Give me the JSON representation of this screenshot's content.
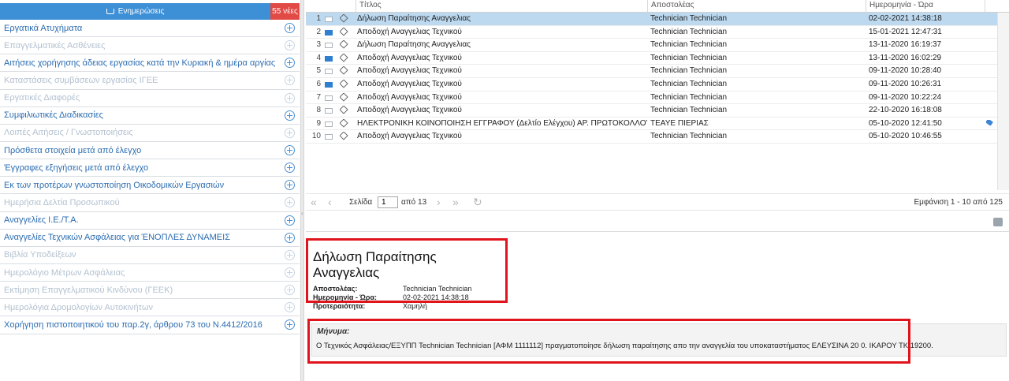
{
  "sidebar": {
    "header_label": "Ενημερώσεις",
    "header_count": "55 νέες",
    "items": [
      {
        "label": "Εργατικά Ατυχήματα",
        "enabled": true
      },
      {
        "label": "Επαγγελματικές Ασθένειες",
        "enabled": false
      },
      {
        "label": "Αιτήσεις χορήγησης άδειας εργασίας κατά την Κυριακή & ημέρα αργίας",
        "enabled": true
      },
      {
        "label": "Καταστάσεις συμβάσεων εργασίας ΙΓΕΕ",
        "enabled": false
      },
      {
        "label": "Εργατικές Διαφορές",
        "enabled": false
      },
      {
        "label": "Συμφιλιωτικές Διαδικασίες",
        "enabled": true
      },
      {
        "label": "Λοιπές Αιτήσεις / Γνωστοποιήσεις",
        "enabled": false
      },
      {
        "label": "Πρόσθετα στοιχεία μετά από έλεγχο",
        "enabled": true
      },
      {
        "label": "Έγγραφες εξηγήσεις μετά από έλεγχο",
        "enabled": true
      },
      {
        "label": "Εκ των προτέρων γνωστοποίηση Οικοδομικών Εργασιών",
        "enabled": true
      },
      {
        "label": "Ημερήσια Δελτία Προσωπικού",
        "enabled": false
      },
      {
        "label": "Αναγγελίες Ι.Ε./Τ.Α.",
        "enabled": true
      },
      {
        "label": "Αναγγελίες Τεχνικών Ασφάλειας για ΈΝΟΠΛΕΣ ΔΥΝΑΜΕΙΣ",
        "enabled": true
      },
      {
        "label": "Βιβλία Υποδείξεων",
        "enabled": false
      },
      {
        "label": "Ημερολόγιο Μέτρων Ασφάλειας",
        "enabled": false
      },
      {
        "label": "Εκτίμηση Επαγγελματικού Κινδύνου (ΓΕΕΚ)",
        "enabled": false
      },
      {
        "label": "Ημερολόγια Δρομολογίων Αυτοκινήτων",
        "enabled": false
      },
      {
        "label": "Χορήγηση πιστοποιητικού του παρ.2γ, άρθρου 73 του Ν.4412/2016",
        "enabled": true
      }
    ]
  },
  "grid": {
    "columns": {
      "title": "Τίτλος",
      "sender": "Αποστολέας",
      "date": "Ημερομηνία - Ώρα"
    },
    "rows": [
      {
        "num": "1",
        "read": true,
        "title": "Δήλωση Παραίτησης Αναγγελιας",
        "sender": "Technician Technician",
        "date": "02-02-2021 14:38:18",
        "selected": true,
        "tag": false
      },
      {
        "num": "2",
        "read": false,
        "title": "Αποδοχή Αναγγελιας Τεχνικού",
        "sender": "Technician Technician",
        "date": "15-01-2021 12:47:31",
        "selected": false,
        "tag": false
      },
      {
        "num": "3",
        "read": true,
        "title": "Δήλωση Παραίτησης Αναγγελιας",
        "sender": "Technician Technician",
        "date": "13-11-2020 16:19:37",
        "selected": false,
        "tag": false
      },
      {
        "num": "4",
        "read": false,
        "title": "Αποδοχή Αναγγελιας Τεχνικού",
        "sender": "Technician Technician",
        "date": "13-11-2020 16:02:29",
        "selected": false,
        "tag": false
      },
      {
        "num": "5",
        "read": true,
        "title": "Αποδοχή Αναγγελιας Τεχνικού",
        "sender": "Technician Technician",
        "date": "09-11-2020 10:28:40",
        "selected": false,
        "tag": false
      },
      {
        "num": "6",
        "read": false,
        "title": "Αποδοχή Αναγγελιας Τεχνικού",
        "sender": "Technician Technician",
        "date": "09-11-2020 10:26:31",
        "selected": false,
        "tag": false
      },
      {
        "num": "7",
        "read": true,
        "title": "Αποδοχή Αναγγελιας Τεχνικού",
        "sender": "Technician Technician",
        "date": "09-11-2020 10:22:24",
        "selected": false,
        "tag": false
      },
      {
        "num": "8",
        "read": true,
        "title": "Αποδοχή Αναγγελιας Τεχνικού",
        "sender": "Technician Technician",
        "date": "22-10-2020 16:18:08",
        "selected": false,
        "tag": false
      },
      {
        "num": "9",
        "read": true,
        "title": "ΗΛΕΚΤΡΟΝΙΚΗ ΚΟΙΝΟΠΟΙΗΣΗ ΕΓΓΡΑΦΟΥ (Δελτίο Ελέγχου) ΑΡ. ΠΡΩΤΟΚΟΛΛΟΥ: ΕΞ-9...",
        "sender": "ΤΕΑΥΕ ΠΙΕΡΙΑΣ",
        "date": "05-10-2020 12:41:50",
        "selected": false,
        "tag": true
      },
      {
        "num": "10",
        "read": true,
        "title": "Αποδοχή Αναγγελιας Τεχνικού",
        "sender": "Technician Technician",
        "date": "05-10-2020 10:46:55",
        "selected": false,
        "tag": false
      }
    ]
  },
  "pager": {
    "page_label": "Σελίδα",
    "page_value": "1",
    "of_label": "από 13",
    "showing": "Εμφάνιση 1 - 10 από 125"
  },
  "detail": {
    "subject": "Δήλωση Παραίτησης Αναγγελιας",
    "sender_label": "Αποστολέας:",
    "sender_value": "Technician Technician",
    "date_label": "Ημερομηνία - Ώρα:",
    "date_value": "02-02-2021 14:38:18",
    "priority_label": "Προτεραιότητα:",
    "priority_value": "Χαμηλή",
    "message_label": "Μήνυμα:",
    "message_text": "Ο Τεχνικός Ασφάλειας/ΕΞΥΠΠ Technician Technician [ΑΦΜ 1111112] πραγματοποίησε δήλωση παραίτησης απο την αναγγελία του υποκαταστήματος ΕΛΕΥΣΙΝΑ 20 0. ΙΚΑΡΟΥ      ΤΚ 19200."
  },
  "colors": {
    "accent": "#3d8fd6",
    "badge": "#e14a45",
    "selection": "#bcd9f0",
    "highlight_border": "#e0141c"
  }
}
